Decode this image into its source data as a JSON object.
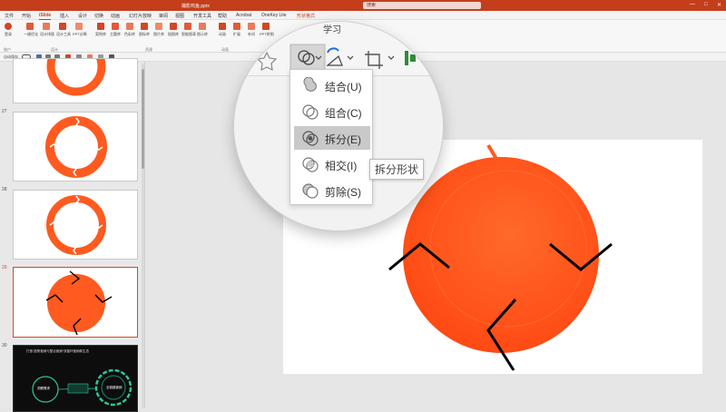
{
  "titlebar": {
    "file": "撮影鸡鱼.pptx",
    "search_placeholder": "搜索"
  },
  "menu": {
    "tabs": [
      "文件",
      "开始",
      "iSlide",
      "插入",
      "设计",
      "切换",
      "动画",
      "幻灯片放映",
      "审阅",
      "视图",
      "开发工具",
      "帮助",
      "Acrobat",
      "OneKey Lite",
      "形状格式"
    ]
  },
  "ribbon": {
    "buttons": [
      "一键优化",
      "设计排版",
      "设计工具",
      "PPT诊断",
      "案例库",
      "主题库",
      "色彩库",
      "图标库",
      "图片库",
      "插图库",
      "智能图表",
      "图示库",
      "动画",
      "扩展",
      "补间",
      "PPT拼图",
      "PPT瘦身",
      "导出"
    ],
    "groups": [
      "账户",
      "设计",
      "资源",
      "动画",
      "工具"
    ],
    "login_label": "登录"
  },
  "fmtbar": {
    "autosave": "自动保存"
  },
  "slides": [
    {
      "number": "27"
    },
    {
      "number": "28"
    },
    {
      "number": "29"
    },
    {
      "number": "30"
    }
  ],
  "magnifier": {
    "ribbon_label": "学习",
    "menu_items": [
      {
        "label": "结合(U)"
      },
      {
        "label": "组合(C)"
      },
      {
        "label": "拆分(E)"
      },
      {
        "label": "相交(I)"
      },
      {
        "label": "剪除(S)"
      }
    ],
    "tooltip": "拆分形状"
  },
  "slide30": {
    "headline": "打造\"趋势营销与整合营销\"双循环营销新生态",
    "button1": "洞察需求",
    "button2": "全链路营销"
  },
  "colors": {
    "accent": "#c43e1c",
    "shape_fill": "#ff5a1f",
    "selection": "#d24726"
  }
}
